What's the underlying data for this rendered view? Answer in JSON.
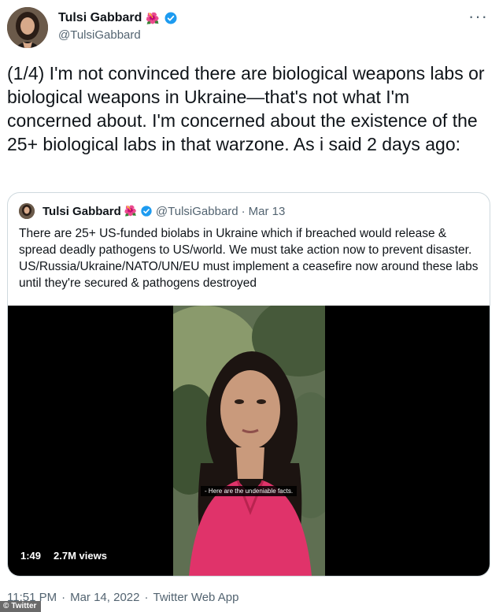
{
  "tweet": {
    "author_name": "Tulsi Gabbard",
    "author_handle": "@TulsiGabbard",
    "name_emoji": "🌺",
    "more_label": "···",
    "text": "(1/4) I'm not convinced there are biological weapons labs or biological weapons in Ukraine—that's not what I'm concerned about. I'm concerned about the existence of the 25+ biological labs in that warzone. As i said 2 days ago:",
    "time": "11:51 PM",
    "date": "Mar 14, 2022",
    "source": "Twitter Web App",
    "separator": "·"
  },
  "quote": {
    "author_name": "Tulsi Gabbard",
    "name_emoji": "🌺",
    "author_handle": "@TulsiGabbard",
    "separator": "·",
    "date": "Mar 13",
    "text": "There are 25+ US-funded biolabs in Ukraine which if breached would release & spread deadly pathogens to US/world. We must take action now to prevent disaster. US/Russia/Ukraine/NATO/UN/EU must implement a ceasefire now around these labs until they're secured & pathogens destroyed",
    "video": {
      "caption": "- Here are the undeniable facts.",
      "duration": "1:49",
      "views": "2.7M views"
    }
  },
  "watermark": {
    "symbol": "©",
    "label": "Twitter"
  },
  "colors": {
    "verified": "#1d9bf0",
    "secondary_text": "#536471",
    "border": "#cfd9de",
    "shirt": "#e0336a"
  }
}
